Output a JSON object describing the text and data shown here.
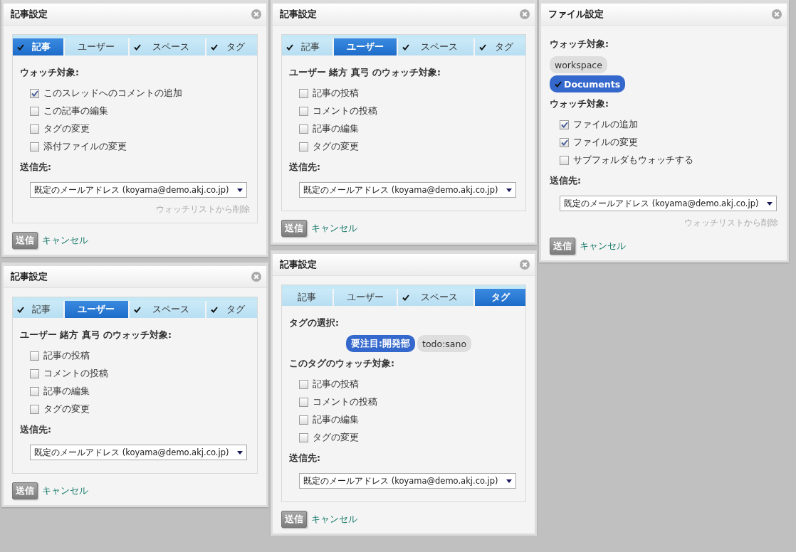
{
  "columns": [
    {
      "dialogs": [
        {
          "title": "記事設定",
          "tabs": [
            {
              "label": "記事",
              "checked": true,
              "selected": true
            },
            {
              "label": "ユーザー",
              "checked": false,
              "selected": false
            },
            {
              "label": "スペース",
              "checked": true,
              "selected": false
            },
            {
              "label": "タグ",
              "checked": true,
              "selected": false
            }
          ],
          "blocks": [
            {
              "kind": "heading",
              "text": "ウォッチ対象:"
            },
            {
              "kind": "checkbox",
              "label": "このスレッドへのコメントの追加",
              "checked": true
            },
            {
              "kind": "checkbox",
              "label": "この記事の編集",
              "checked": false
            },
            {
              "kind": "checkbox",
              "label": "タグの変更",
              "checked": false
            },
            {
              "kind": "checkbox",
              "label": "添付ファイルの変更",
              "checked": false
            },
            {
              "kind": "heading",
              "text": "送信先:"
            },
            {
              "kind": "select",
              "value": "既定のメールアドレス (koyama@demo.akj.co.jp)"
            },
            {
              "kind": "remove-link",
              "text": "ウォッチリストから削除"
            }
          ],
          "submit": "送信",
          "cancel": "キャンセル"
        },
        {
          "title": "記事設定",
          "tabs": [
            {
              "label": "記事",
              "checked": true,
              "selected": false
            },
            {
              "label": "ユーザー",
              "checked": false,
              "selected": true
            },
            {
              "label": "スペース",
              "checked": true,
              "selected": false
            },
            {
              "label": "タグ",
              "checked": true,
              "selected": false
            }
          ],
          "blocks": [
            {
              "kind": "heading",
              "text": "ユーザー 緒方 真弓 のウォッチ対象:"
            },
            {
              "kind": "checkbox",
              "label": "記事の投稿",
              "checked": false
            },
            {
              "kind": "checkbox",
              "label": "コメントの投稿",
              "checked": false
            },
            {
              "kind": "checkbox",
              "label": "記事の編集",
              "checked": false
            },
            {
              "kind": "checkbox",
              "label": "タグの変更",
              "checked": false
            },
            {
              "kind": "heading",
              "text": "送信先:"
            },
            {
              "kind": "select",
              "value": "既定のメールアドレス (koyama@demo.akj.co.jp)"
            }
          ],
          "submit": "送信",
          "cancel": "キャンセル"
        }
      ]
    },
    {
      "dialogs": [
        {
          "title": "記事設定",
          "tabs": [
            {
              "label": "記事",
              "checked": true,
              "selected": false
            },
            {
              "label": "ユーザー",
              "checked": false,
              "selected": true
            },
            {
              "label": "スペース",
              "checked": true,
              "selected": false
            },
            {
              "label": "タグ",
              "checked": true,
              "selected": false
            }
          ],
          "blocks": [
            {
              "kind": "heading",
              "text": "ユーザー 緒方 真弓 のウォッチ対象:"
            },
            {
              "kind": "checkbox",
              "label": "記事の投稿",
              "checked": false
            },
            {
              "kind": "checkbox",
              "label": "コメントの投稿",
              "checked": false
            },
            {
              "kind": "checkbox",
              "label": "記事の編集",
              "checked": false
            },
            {
              "kind": "checkbox",
              "label": "タグの変更",
              "checked": false
            },
            {
              "kind": "heading",
              "text": "送信先:"
            },
            {
              "kind": "select",
              "value": "既定のメールアドレス (koyama@demo.akj.co.jp)"
            }
          ],
          "submit": "送信",
          "cancel": "キャンセル"
        },
        {
          "title": "記事設定",
          "tabs": [
            {
              "label": "記事",
              "checked": false,
              "selected": false
            },
            {
              "label": "ユーザー",
              "checked": false,
              "selected": false
            },
            {
              "label": "スペース",
              "checked": true,
              "selected": false
            },
            {
              "label": "タグ",
              "checked": false,
              "selected": true
            }
          ],
          "blocks": [
            {
              "kind": "heading",
              "text": "タグの選択:"
            },
            {
              "kind": "chip-row",
              "chips": [
                {
                  "label": "要注目:開発部",
                  "selected": true,
                  "checked": false
                },
                {
                  "label": "todo:sano",
                  "selected": false,
                  "checked": false
                }
              ]
            },
            {
              "kind": "heading",
              "text": "このタグのウォッチ対象:"
            },
            {
              "kind": "checkbox",
              "label": "記事の投稿",
              "checked": false
            },
            {
              "kind": "checkbox",
              "label": "コメントの投稿",
              "checked": false
            },
            {
              "kind": "checkbox",
              "label": "記事の編集",
              "checked": false
            },
            {
              "kind": "checkbox",
              "label": "タグの変更",
              "checked": false
            },
            {
              "kind": "heading",
              "text": "送信先:"
            },
            {
              "kind": "select",
              "value": "既定のメールアドレス (koyama@demo.akj.co.jp)"
            }
          ],
          "submit": "送信",
          "cancel": "キャンセル"
        }
      ]
    },
    {
      "dialogs": [
        {
          "title": "ファイル設定",
          "blocks": [
            {
              "kind": "heading",
              "text": "ウォッチ対象:"
            },
            {
              "kind": "chip-stack",
              "chips": [
                {
                  "label": "workspace",
                  "selected": false,
                  "checked": false
                },
                {
                  "label": "Documents",
                  "selected": true,
                  "checked": true
                }
              ]
            },
            {
              "kind": "heading",
              "text": "ウォッチ対象:"
            },
            {
              "kind": "checkbox",
              "label": "ファイルの追加",
              "checked": true
            },
            {
              "kind": "checkbox",
              "label": "ファイルの変更",
              "checked": true
            },
            {
              "kind": "checkbox",
              "label": "サブフォルダもウォッチする",
              "checked": false
            },
            {
              "kind": "heading",
              "text": "送信先:"
            },
            {
              "kind": "select",
              "value": "既定のメールアドレス (koyama@demo.akj.co.jp)"
            },
            {
              "kind": "remove-link",
              "text": "ウォッチリストから削除"
            }
          ],
          "submit": "送信",
          "cancel": "キャンセル"
        }
      ]
    }
  ]
}
